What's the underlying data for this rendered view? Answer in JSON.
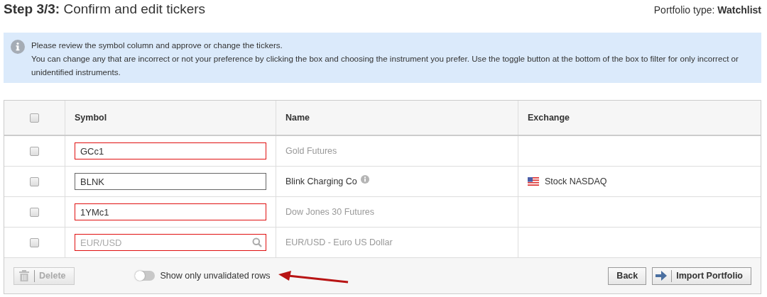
{
  "header": {
    "title": "**Step 3/3:** Confirm and edit tickers",
    "portfolio_type": "Portfolio type: **Watchlist**"
  },
  "notice": {
    "lines": [
      "Please review the symbol column and approve or change the tickers.",
      "You can change any that are incorrect or not your preference by clicking the box and choosing the instrument you prefer. Use the toggle button at the bottom of the box to filter for only incorrect or unidentified instruments."
    ]
  },
  "table": {
    "select_all": {
      "checked": false
    },
    "columns": [
      "Symbol",
      "Name",
      "Exchange"
    ],
    "rows": [
      {
        "checked": false,
        "symbol": {
          "value": "GCc1",
          "valid": false
        },
        "name": "Gold Futures",
        "info": false
      },
      {
        "checked": false,
        "symbol": {
          "value": "BLNK",
          "valid": true
        },
        "name": "Blink Charging Co",
        "info": true,
        "exchange": "Stock NASDAQ"
      },
      {
        "checked": false,
        "symbol": {
          "value": "1YMc1",
          "valid": false
        },
        "name": "Dow Jones 30 Futures",
        "info": false
      },
      {
        "checked": false,
        "symbol": {
          "placeholder": "EUR/USD",
          "valid": false
        },
        "name": "EUR/USD - Euro US Dollar",
        "info": false
      }
    ]
  },
  "footer": {
    "delete": {
      "label": "Delete",
      "disabled": true
    },
    "toggle": {
      "label": "Show only unvalidated rows",
      "on": false
    },
    "back": "Back",
    "import": "Import Portfolio"
  }
}
